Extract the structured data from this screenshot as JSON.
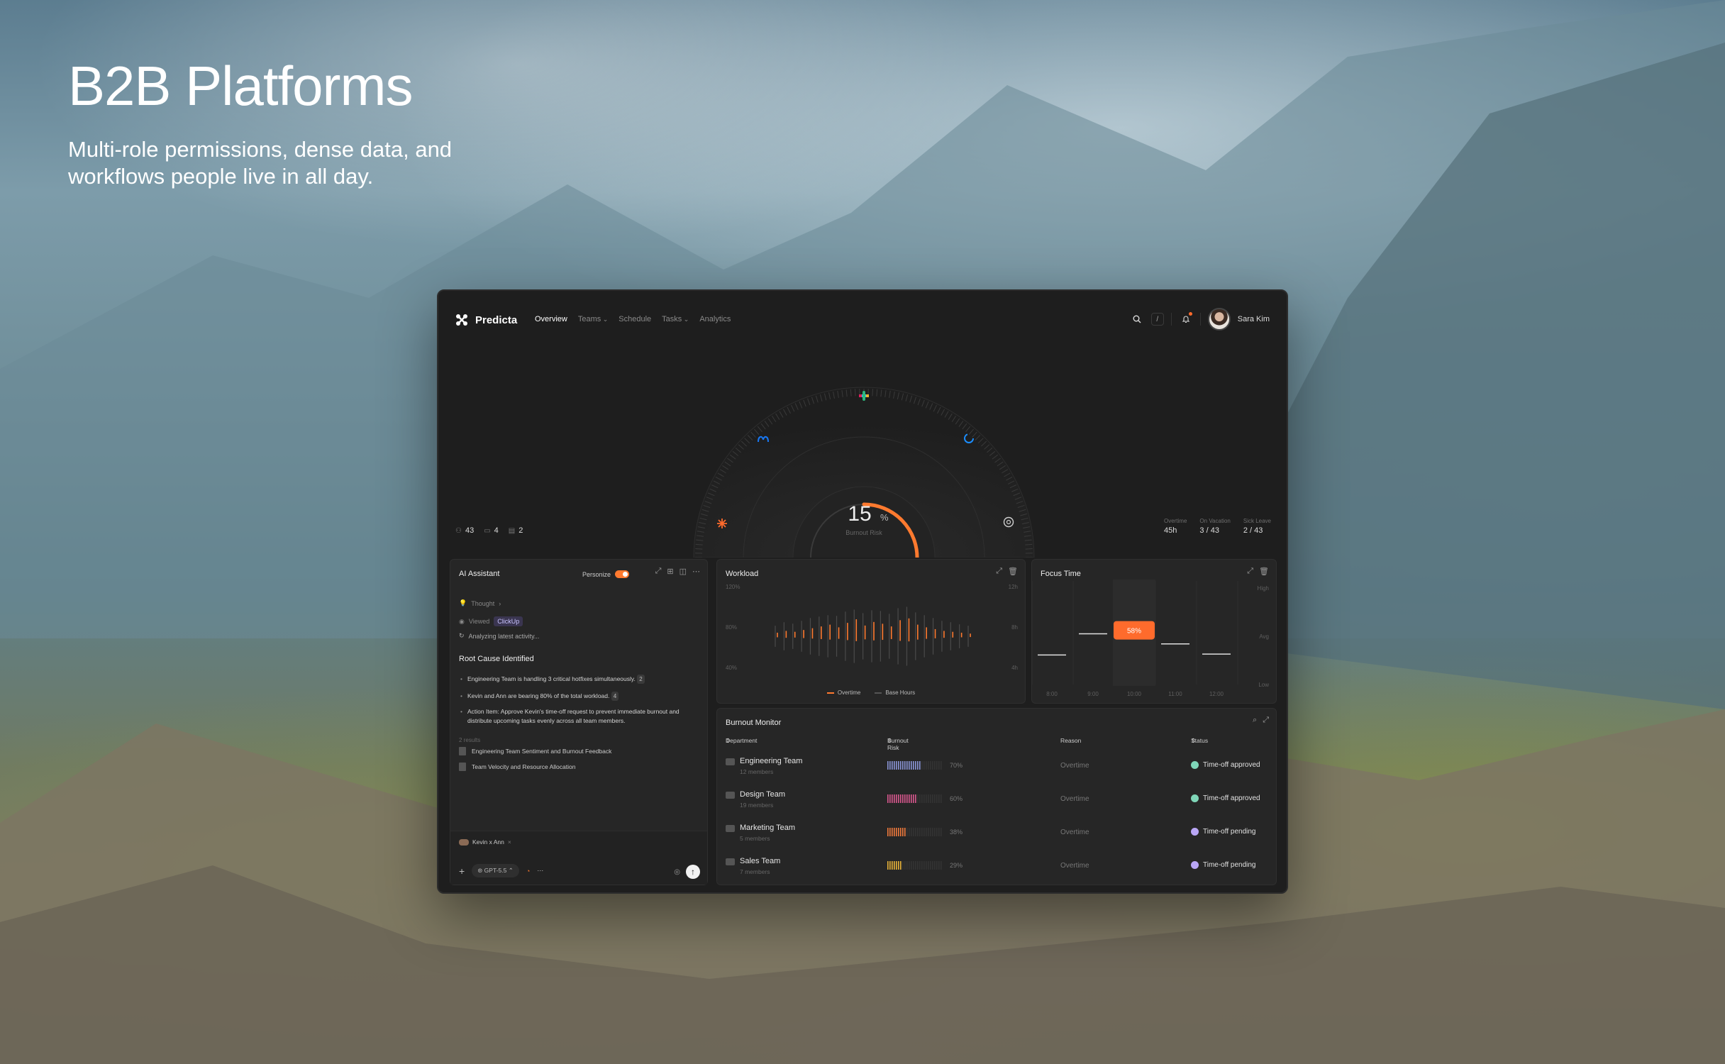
{
  "hero": {
    "title": "B2B Platforms",
    "subtitle": "Multi-role permissions, dense data, and workflows people live in all day."
  },
  "app": {
    "brand": "Predicta",
    "nav": [
      {
        "label": "Overview",
        "active": true
      },
      {
        "label": "Teams",
        "dropdown": true
      },
      {
        "label": "Schedule"
      },
      {
        "label": "Tasks",
        "dropdown": true
      },
      {
        "label": "Analytics"
      }
    ],
    "search_shortcut": "/",
    "user": {
      "name": "Sara Kim"
    }
  },
  "gauge": {
    "value": "15",
    "unit": "%",
    "label": "Burnout Risk",
    "fraction": 0.15,
    "integrations": [
      "slack-icon",
      "meta-icon",
      "loop-icon",
      "claude-icon",
      "openai-icon"
    ]
  },
  "summary_left": [
    {
      "icon": "people-icon",
      "value": "43"
    },
    {
      "icon": "folder-icon",
      "value": "4"
    },
    {
      "icon": "doc-icon",
      "value": "2"
    }
  ],
  "summary_right": [
    {
      "label": "Overtime",
      "value": "45h"
    },
    {
      "label": "On Vacation",
      "value": "3 / 43"
    },
    {
      "label": "Sick Leave",
      "value": "2 / 43"
    }
  ],
  "ai_assistant": {
    "title": "AI Assistant",
    "personalize_label": "Personize",
    "thought": "Thought",
    "viewed": "Viewed",
    "viewed_chip": "ClickUp",
    "analyzing": "Analyzing latest activity...",
    "root_title": "Root Cause Identified",
    "bullets": [
      {
        "text": "Engineering Team is handling 3 critical hotfixes simultaneously.",
        "badge": "2"
      },
      {
        "text": "Kevin and Ann are bearing 80% of the total workload.",
        "badge": "4"
      },
      {
        "text": "Action Item: Approve Kevin's time-off request to prevent immediate burnout and distribute upcoming tasks evenly across all team members.",
        "badge": ""
      }
    ],
    "results_label": "2 results",
    "results": [
      "Engineering Team Sentiment and Burnout Feedback",
      "Team Velocity and Resource Allocation"
    ],
    "context_tag": "Kevin x Ann",
    "model": "GPT-5.5"
  },
  "workload": {
    "title": "Workload",
    "y_left": [
      "120%",
      "80%",
      "40%"
    ],
    "y_right": [
      "12h",
      "8h",
      "4h"
    ],
    "legend": [
      "Overtime",
      "Base Hours"
    ],
    "colors": {
      "overtime": "#ff7a2f",
      "base": "#4a4a4a"
    },
    "chart_data": {
      "type": "bar",
      "series": [
        {
          "name": "Overtime",
          "values": [
            8,
            12,
            10,
            14,
            18,
            22,
            26,
            20,
            30,
            38,
            24,
            32,
            28,
            22,
            36,
            40,
            26,
            20,
            16,
            12,
            10,
            8,
            6
          ]
        },
        {
          "name": "Base Hours",
          "values": [
            30,
            40,
            36,
            44,
            52,
            56,
            60,
            58,
            70,
            76,
            66,
            74,
            72,
            64,
            80,
            84,
            68,
            60,
            52,
            44,
            40,
            34,
            30
          ]
        }
      ]
    }
  },
  "focus_time": {
    "title": "Focus Time",
    "y_labels": [
      "High",
      "Avg",
      "Low"
    ],
    "x_labels": [
      "8:00",
      "9:00",
      "10:00",
      "11:00",
      "12:00"
    ],
    "peak_label": "58%",
    "levels": [
      0.32,
      0.55,
      0.58,
      0.44,
      0.33
    ],
    "highlight_index": 2
  },
  "burnout_monitor": {
    "title": "Burnout Monitor",
    "columns": [
      "Department",
      "Burnout Risk",
      "Reason",
      "Status"
    ],
    "rows": [
      {
        "dept": "Engineering Team",
        "members": "12 members",
        "risk": "70%",
        "risk_value": 0.7,
        "color": "#8b96d8",
        "reason": "Overtime",
        "status": "Time-off approved",
        "status_color": "#7fd6b8"
      },
      {
        "dept": "Design Team",
        "members": "19 members",
        "risk": "60%",
        "risk_value": 0.6,
        "color": "#d9588f",
        "reason": "Overtime",
        "status": "Time-off approved",
        "status_color": "#7fd6b8"
      },
      {
        "dept": "Marketing Team",
        "members": "5 members",
        "risk": "38%",
        "risk_value": 0.38,
        "color": "#f07a3c",
        "reason": "Overtime",
        "status": "Time-off pending",
        "status_color": "#b9a6f5"
      },
      {
        "dept": "Sales Team",
        "members": "7 members",
        "risk": "29%",
        "risk_value": 0.29,
        "color": "#e8b339",
        "reason": "Overtime",
        "status": "Time-off pending",
        "status_color": "#b9a6f5"
      }
    ]
  }
}
